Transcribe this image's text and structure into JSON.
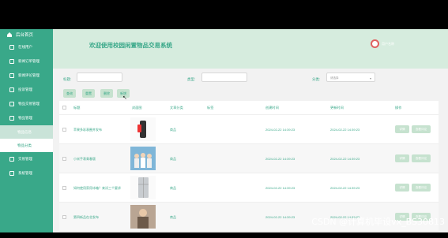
{
  "sidebar": {
    "home_label": "后台首页",
    "items": [
      {
        "label": "在线用户",
        "icon": "user-icon"
      },
      {
        "label": "新闻订单管理",
        "icon": "order-icon"
      },
      {
        "label": "新闻评论管理",
        "icon": "comment-icon"
      },
      {
        "label": "投诉管理",
        "icon": "complaint-icon"
      },
      {
        "label": "物品交易管理",
        "icon": "trade-icon"
      },
      {
        "label": "物品管理",
        "icon": "goods-icon"
      }
    ],
    "sub_items": [
      {
        "label": "物品信息",
        "active": true
      },
      {
        "label": "物品分类",
        "active": false
      }
    ],
    "bottom_items": [
      {
        "label": "交易管理",
        "icon": "deal-icon"
      },
      {
        "label": "系统管理",
        "icon": "system-icon"
      }
    ]
  },
  "header": {
    "title": "欢迎使用校园闲置物品交易系统",
    "user": "用户名称"
  },
  "filters": {
    "title_label": "标题:",
    "type_label": "类型:",
    "category_label": "分类:",
    "category_placeholder": "请选择"
  },
  "actions": {
    "search": "查询",
    "reset": "重置",
    "delete": "删除",
    "add": "新增"
  },
  "table": {
    "headers": [
      "标题",
      "封面图",
      "文章分类",
      "标签",
      "创建时间",
      "更新时间",
      "操作"
    ],
    "rows": [
      {
        "title": "苹果多彩表圈并发布",
        "category": "商品",
        "created": "2024-02-22 14:39:23",
        "updated": "2024-02-22 14:39:23",
        "thumb": "watch",
        "btn_detail": "详情",
        "btn_comment": "查看评论"
      },
      {
        "title": "小米手表青春版",
        "category": "商品",
        "created": "2024-02-22 14:39:23",
        "updated": "2024-02-22 14:39:23",
        "thumb": "people",
        "btn_detail": "详情",
        "btn_comment": "查看评论"
      },
      {
        "title": "如何使用家用冰箱？来试三个要求",
        "category": "商品",
        "created": "2024-02-22 14:39:23",
        "updated": "2024-02-22 14:39:23",
        "thumb": "fridge",
        "btn_detail": "详情",
        "btn_comment": "查看评论"
      },
      {
        "title": "第四新品在北发布",
        "category": "商品",
        "created": "2024-02-22 14:39:23",
        "updated": "2024-02-22 14:39:23",
        "thumb": "product",
        "btn_detail": "详情",
        "btn_comment": "查看评论"
      }
    ]
  },
  "watermark": "CSDN @计算机毕设vx_BS30813",
  "colors": {
    "accent": "#39a889",
    "header_bg": "#d6ecde",
    "button_bg": "#c6e2cf"
  }
}
